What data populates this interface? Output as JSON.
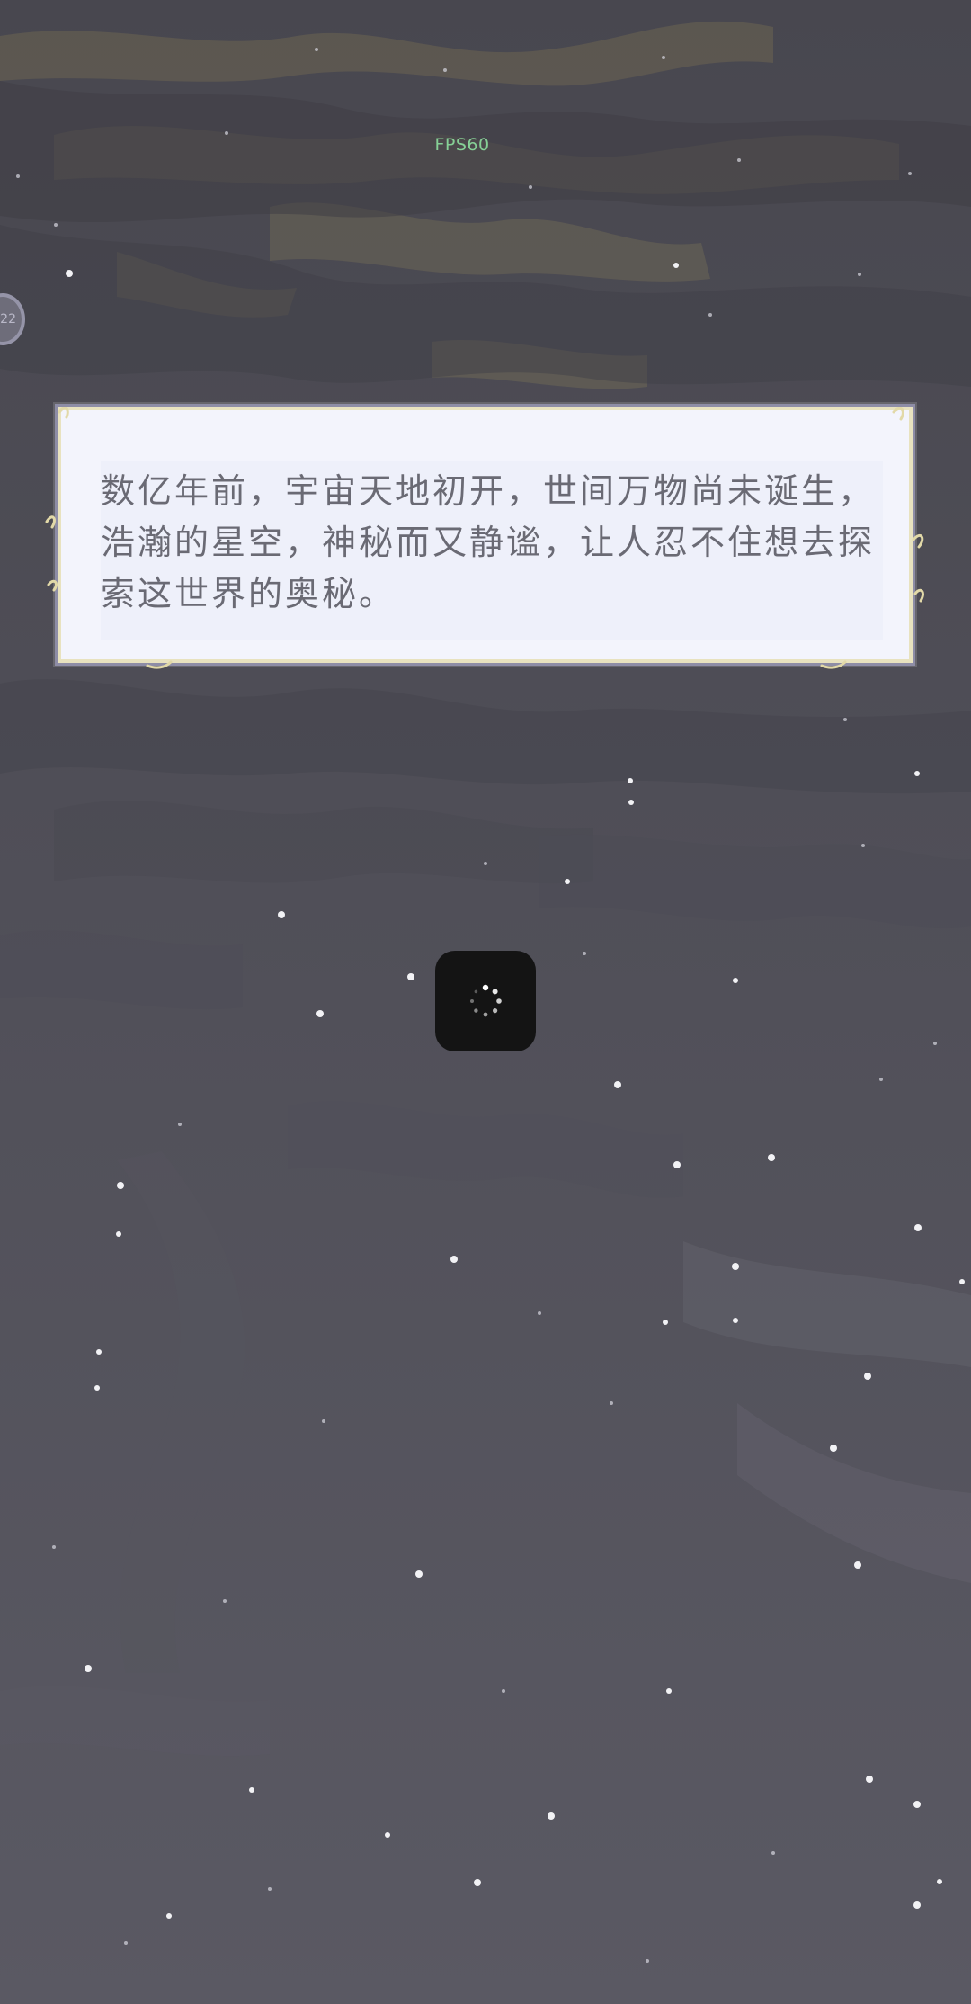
{
  "hud": {
    "fps": "FPS60",
    "fps_color": "#86d096",
    "side_badge": "22"
  },
  "dialog": {
    "text": "数亿年前，宇宙天地初开，世间万物尚未诞生，浩瀚的星空，神秘而又静谧，让人忍不住想去探索这世界的奥秘。"
  },
  "loading": {
    "icon": "spinner-icon"
  },
  "colors": {
    "background": "#5d5c66",
    "dialog_bg": "#f3f4fc",
    "dialog_border": "#e8e2bf",
    "dialog_text": "#6a6a74",
    "spinner_bg": "#141414"
  }
}
